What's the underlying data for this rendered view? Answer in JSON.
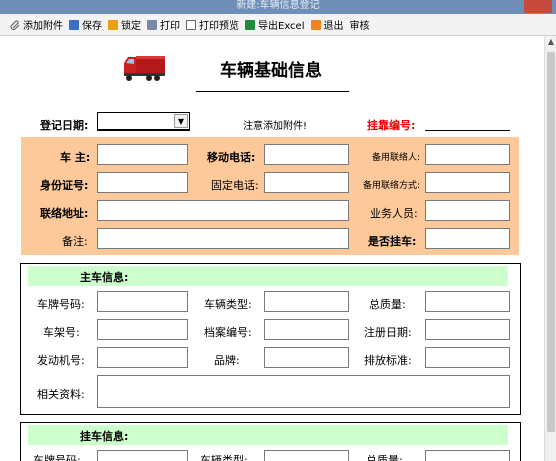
{
  "window": {
    "title": "新建:车辆信息登记"
  },
  "toolbar": {
    "attach": "添加附件",
    "save": "保存",
    "lock": "锁定",
    "print": "打印",
    "preview": "打印预览",
    "excel": "导出Excel",
    "exit": "退出",
    "review": "审核"
  },
  "form": {
    "title": "车辆基础信息",
    "reg_date_label": "登记日期:",
    "attach_note": "注意添加附件!",
    "trailer_no_label": "挂靠编号:"
  },
  "owner": {
    "owner": "车  主:",
    "mobile": "移动电话:",
    "backup_contact": "备用联络人:",
    "id_no": "身份证号:",
    "phone": "固定电话:",
    "backup_contact_method": "备用联络方式:",
    "address": "联络地址:",
    "staff": "业务人员:",
    "remark": "备注:",
    "is_trailer": "是否挂车:"
  },
  "main_vehicle": {
    "header": "主车信息:",
    "plate": "车牌号码:",
    "type": "车辆类型:",
    "total_mass": "总质量:",
    "frame_no": "车架号:",
    "file_no": "档案编号:",
    "reg_date": "注册日期:",
    "engine_no": "发动机号:",
    "brand": "品牌:",
    "emission": "排放标准:",
    "docs": "相关资料:"
  },
  "trailer_vehicle": {
    "header": "挂车信息:",
    "plate": "车牌号码:",
    "type": "车辆类型:",
    "total_mass": "总质量:"
  }
}
